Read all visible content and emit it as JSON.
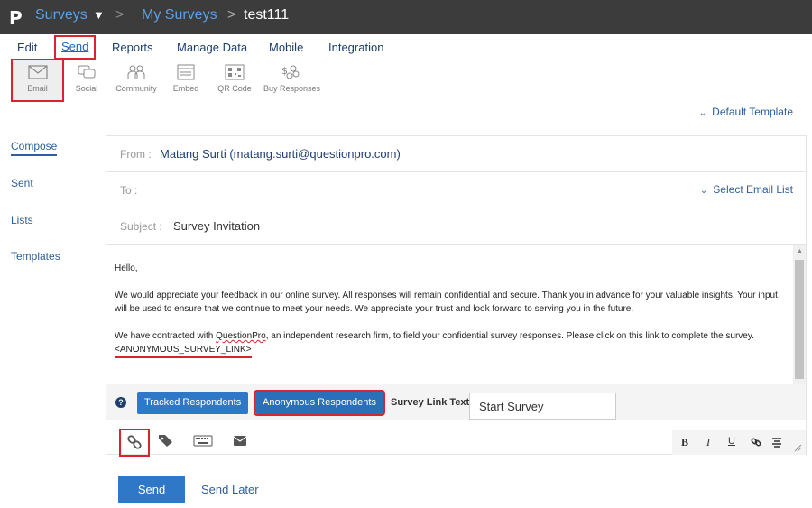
{
  "header": {
    "logo": "P",
    "surveys_label": "Surveys",
    "separator": ">",
    "my_surveys_label": "My Surveys",
    "survey_name": "test111"
  },
  "main_nav": {
    "items": [
      "Edit",
      "Send",
      "Reports",
      "Manage Data",
      "Mobile",
      "Integration"
    ],
    "active": "Send"
  },
  "sub_nav": {
    "items": [
      {
        "label": "Email",
        "icon": "envelope-icon"
      },
      {
        "label": "Social",
        "icon": "social-icon"
      },
      {
        "label": "Community",
        "icon": "community-icon"
      },
      {
        "label": "Embed",
        "icon": "embed-icon"
      },
      {
        "label": "QR Code",
        "icon": "qr-code-icon"
      },
      {
        "label": "Buy Responses",
        "icon": "buy-responses-icon"
      }
    ],
    "active": "Email"
  },
  "template_select": "Default Template",
  "left_menu": {
    "items": [
      "Compose",
      "Sent",
      "Lists",
      "Templates"
    ],
    "active": "Compose"
  },
  "form": {
    "from_label": "From :",
    "from_value": "Matang Surti (matang.surti@questionpro.com)",
    "to_label": "To :",
    "to_value": "",
    "select_list": "Select Email List",
    "subject_label": "Subject :",
    "subject_value": "Survey Invitation"
  },
  "body": {
    "greeting": "Hello,",
    "para1": "We would appreciate your feedback in our online survey.  All responses will remain confidential and secure.  Thank you in advance for your valuable insights.  Your input will be used to ensure that we continue to meet your needs. We appreciate your trust and look forward to serving you in the future.",
    "para2_start": "We have contracted with ",
    "para2_brand": "QuestionPro",
    "para2_end": ", an independent research firm, to field your confidential survey responses.  Please click on this link to complete the survey.",
    "link_tag": "<ANONYMOUS_SURVEY_LINK>"
  },
  "link_bar": {
    "help": "?",
    "tracked_label": "Tracked Respondents",
    "anonymous_label": "Anonymous Respondents",
    "link_text_label": "Survey Link Text:",
    "link_text_value": "Start Survey"
  },
  "format_toolbar": {
    "bold": "B",
    "italic": "I",
    "underline": "U"
  },
  "actions": {
    "send_label": "Send",
    "send_later_label": "Send Later"
  },
  "colors": {
    "topbar": "#3c3c3c",
    "link": "#2e5f9a",
    "button": "#2f78c8",
    "highlight": "#d9232d"
  }
}
